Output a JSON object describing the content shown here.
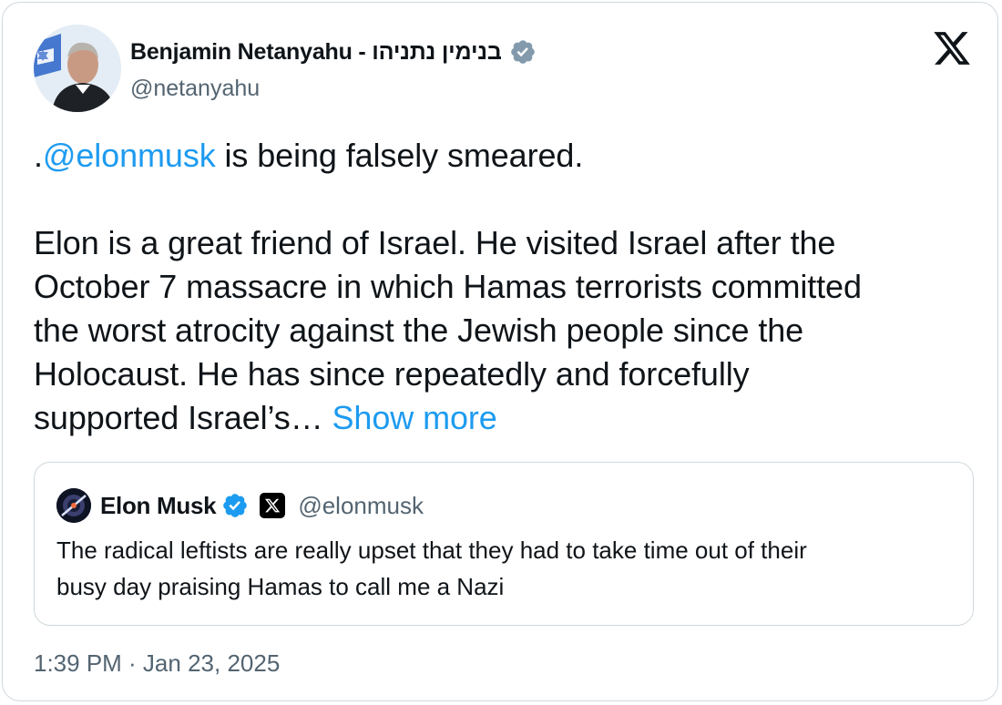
{
  "author": {
    "display_name": "Benjamin Netanyahu - בנימין נתניהו",
    "handle": "@netanyahu",
    "verified": "gray-check-icon"
  },
  "platform_logo": "x-logo-icon",
  "tweet": {
    "mention": "@elonmusk",
    "line1_prefix": ".",
    "line1_rest": " is being falsely smeared.",
    "lines": [
      "Elon is a great friend of Israel.  He visited Israel after the",
      "October 7 massacre in which Hamas terrorists committed",
      "the worst atrocity against the Jewish people since the",
      "Holocaust. He has since repeatedly and forcefully"
    ],
    "last_line": "supported Israel’s… ",
    "show_more": "Show more"
  },
  "quote": {
    "display_name": "Elon Musk",
    "handle": "@elonmusk",
    "verified": "blue-check-icon",
    "affiliate": "x-affiliate-badge",
    "lines": [
      "The radical leftists are really upset that they had to take time out of their",
      "busy day praising Hamas to call me a Nazi"
    ]
  },
  "timestamp": "1:39 PM · Jan 23, 2025",
  "colors": {
    "link": "#1d9bf0",
    "text": "#0f1419",
    "secondary": "#536471",
    "border": "#cfd9de",
    "gray_badge": "#829aab",
    "blue_badge": "#1d9bf0"
  }
}
